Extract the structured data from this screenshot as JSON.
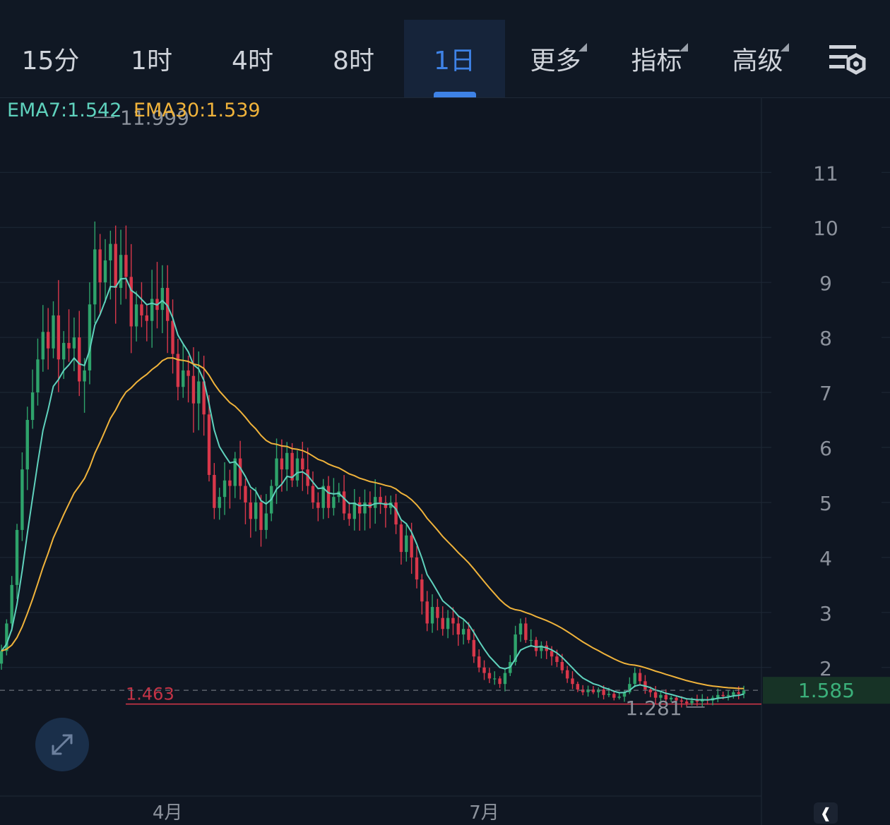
{
  "tabs": [
    {
      "label": "15分",
      "active": false,
      "dropdown": false
    },
    {
      "label": "1时",
      "active": false,
      "dropdown": false
    },
    {
      "label": "4时",
      "active": false,
      "dropdown": false
    },
    {
      "label": "8时",
      "active": false,
      "dropdown": false
    },
    {
      "label": "1日",
      "active": true,
      "dropdown": false
    },
    {
      "label": "更多",
      "active": false,
      "dropdown": true
    },
    {
      "label": "指标",
      "active": false,
      "dropdown": true
    },
    {
      "label": "高级",
      "active": false,
      "dropdown": true
    }
  ],
  "indicators": {
    "ema7": "EMA7:1.542",
    "ema30": "EMA30:1.539"
  },
  "colors": {
    "up": "#2ea36b",
    "down": "#d8374a",
    "ema7": "#5fd2bd",
    "ema30": "#f0b33b",
    "accent": "#3e82e6",
    "background": "#0f1622"
  },
  "icons": [
    "settings-gear-icon",
    "expand-arrows-icon",
    "jump-to-latest-icon"
  ],
  "chart_data": {
    "type": "candlestick",
    "y_ticks": [
      "2",
      "3",
      "4",
      "5",
      "6",
      "7",
      "8",
      "9",
      "10",
      "11"
    ],
    "y_range": [
      1.15,
      12.5
    ],
    "x_ticks": [
      {
        "label": "4月",
        "index": 32
      },
      {
        "label": "7月",
        "index": 93
      }
    ],
    "max_marker": {
      "label": "11.999",
      "value": 11.999,
      "index": 17
    },
    "min_marker": {
      "label": "1.281",
      "value": 1.281,
      "index": 136
    },
    "price_line": {
      "label": "1.463",
      "value": 1.463
    },
    "last_price": {
      "label": "1.585",
      "value": 1.585
    },
    "ema_end": {
      "ema7": 1.542,
      "ema30": 1.539
    },
    "close": [
      2.3,
      2.8,
      3.5,
      4.5,
      5.6,
      6.5,
      7.0,
      7.6,
      8.1,
      7.8,
      8.4,
      7.6,
      7.9,
      7.8,
      8.0,
      7.2,
      7.4,
      8.6,
      9.6,
      9.0,
      9.4,
      9.7,
      8.9,
      9.5,
      9.1,
      8.2,
      8.6,
      8.4,
      8.3,
      8.7,
      8.5,
      8.9,
      8.3,
      7.7,
      7.1,
      7.4,
      7.3,
      6.8,
      7.2,
      6.6,
      5.5,
      4.9,
      5.1,
      5.4,
      5.3,
      5.8,
      5.3,
      5.0,
      4.7,
      5.0,
      4.5,
      4.8,
      5.3,
      5.8,
      5.6,
      5.9,
      5.4,
      5.8,
      5.6,
      5.3,
      5.0,
      4.9,
      5.3,
      4.9,
      5.1,
      5.2,
      4.8,
      4.7,
      5.0,
      4.8,
      5.0,
      4.9,
      5.1,
      5.0,
      4.9,
      5.0,
      4.6,
      4.1,
      4.4,
      4.0,
      3.6,
      3.2,
      2.8,
      3.1,
      2.9,
      2.7,
      2.9,
      2.8,
      2.6,
      2.7,
      2.5,
      2.2,
      2.0,
      1.9,
      1.8,
      1.8,
      1.7,
      1.9,
      2.1,
      2.6,
      2.8,
      2.5,
      2.5,
      2.3,
      2.4,
      2.3,
      2.2,
      2.1,
      1.95,
      1.8,
      1.7,
      1.6,
      1.55,
      1.6,
      1.55,
      1.6,
      1.5,
      1.52,
      1.45,
      1.47,
      1.55,
      1.7,
      1.9,
      1.75,
      1.6,
      1.55,
      1.45,
      1.5,
      1.42,
      1.45,
      1.4,
      1.38,
      1.35,
      1.4,
      1.38,
      1.42,
      1.4,
      1.45,
      1.5,
      1.48,
      1.5,
      1.55,
      1.52,
      1.585
    ]
  }
}
